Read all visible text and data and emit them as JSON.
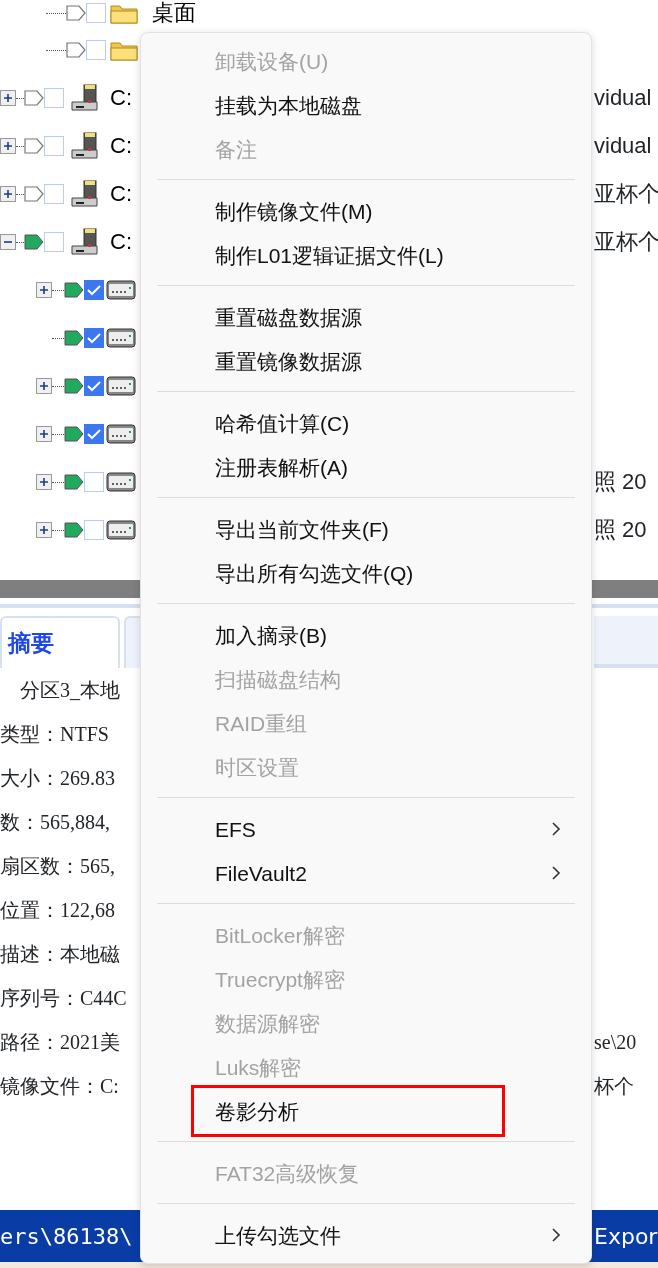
{
  "tree": {
    "cut_off_branch": [
      {
        "kind": "folder",
        "label": "桌面",
        "marked": false,
        "checked": false
      },
      {
        "kind": "folder",
        "marked": false,
        "checked": false
      }
    ],
    "nodes": [
      {
        "kind": "drive",
        "label": "C:",
        "tail": "vidual",
        "expanded": false,
        "marked": false,
        "checked": false
      },
      {
        "kind": "drive",
        "label": "C:",
        "tail": "vidual",
        "expanded": false,
        "marked": false,
        "checked": false
      },
      {
        "kind": "drive",
        "label": "C:",
        "tail": "亚杯个",
        "expanded": false,
        "marked": false,
        "checked": false
      },
      {
        "kind": "drive",
        "label": "C:",
        "tail": "亚杯个",
        "expanded": true,
        "marked": true,
        "checked": false,
        "children": [
          {
            "kind": "volume",
            "expanded": false,
            "marked": true,
            "checked": true
          },
          {
            "kind": "volume",
            "marked": true,
            "checked": true
          },
          {
            "kind": "volume",
            "expanded": false,
            "marked": true,
            "checked": true
          },
          {
            "kind": "volume",
            "expanded": false,
            "marked": true,
            "checked": true
          },
          {
            "kind": "volume",
            "tail": "照 20",
            "expanded": false,
            "marked": true,
            "checked": false
          },
          {
            "kind": "volume",
            "tail": "照 20",
            "expanded": false,
            "marked": true,
            "checked": false
          }
        ]
      }
    ]
  },
  "panel": {
    "tabs": [
      {
        "label": "摘要",
        "selected": true
      }
    ],
    "lines": [
      {
        "text": "分区3_本地",
        "indent": true
      },
      {
        "text": "类型：NTFS"
      },
      {
        "text": "大小：269.83"
      },
      {
        "text": "数：565,884,"
      },
      {
        "text": "扇区数：565,"
      },
      {
        "text": "位置：122,68"
      },
      {
        "text": "描述：本地磁"
      },
      {
        "text": "序列号：C44C"
      },
      {
        "text": "路径：2021美",
        "tail": "se\\20"
      },
      {
        "text": "镜像文件：C:",
        "tail": "杯个"
      }
    ]
  },
  "status_bar": {
    "left": "ers\\86138\\",
    "right": "Expor"
  },
  "context_menu": {
    "entries": [
      {
        "kind": "item",
        "label": "卸载设备(U)",
        "disabled": true
      },
      {
        "kind": "item",
        "label": "挂载为本地磁盘",
        "disabled": false
      },
      {
        "kind": "item",
        "label": "备注",
        "disabled": true
      },
      {
        "kind": "separator"
      },
      {
        "kind": "item",
        "label": "制作镜像文件(M)",
        "disabled": false
      },
      {
        "kind": "item",
        "label": "制作L01逻辑证据文件(L)",
        "disabled": false
      },
      {
        "kind": "separator"
      },
      {
        "kind": "item",
        "label": "重置磁盘数据源",
        "disabled": false
      },
      {
        "kind": "item",
        "label": "重置镜像数据源",
        "disabled": false
      },
      {
        "kind": "separator"
      },
      {
        "kind": "item",
        "label": "哈希值计算(C)",
        "disabled": false
      },
      {
        "kind": "item",
        "label": "注册表解析(A)",
        "disabled": false
      },
      {
        "kind": "separator"
      },
      {
        "kind": "item",
        "label": "导出当前文件夹(F)",
        "disabled": false
      },
      {
        "kind": "item",
        "label": "导出所有勾选文件(Q)",
        "disabled": false
      },
      {
        "kind": "separator"
      },
      {
        "kind": "item",
        "label": "加入摘录(B)",
        "disabled": false
      },
      {
        "kind": "item",
        "label": "扫描磁盘结构",
        "disabled": true
      },
      {
        "kind": "item",
        "label": "RAID重组",
        "disabled": true
      },
      {
        "kind": "item",
        "label": "时区设置",
        "disabled": true
      },
      {
        "kind": "separator"
      },
      {
        "kind": "item",
        "label": "EFS",
        "disabled": false,
        "submenu": true
      },
      {
        "kind": "item",
        "label": "FileVault2",
        "disabled": false,
        "submenu": true
      },
      {
        "kind": "separator"
      },
      {
        "kind": "item",
        "label": "BitLocker解密",
        "disabled": true
      },
      {
        "kind": "item",
        "label": "Truecrypt解密",
        "disabled": true
      },
      {
        "kind": "item",
        "label": "数据源解密",
        "disabled": true
      },
      {
        "kind": "item",
        "label": "Luks解密",
        "disabled": true
      },
      {
        "kind": "item",
        "label": "卷影分析",
        "disabled": false,
        "highlighted": true
      },
      {
        "kind": "separator"
      },
      {
        "kind": "item",
        "label": "FAT32高级恢复",
        "disabled": true
      },
      {
        "kind": "separator"
      },
      {
        "kind": "item",
        "label": "上传勾选文件",
        "disabled": false,
        "submenu": true
      }
    ]
  }
}
